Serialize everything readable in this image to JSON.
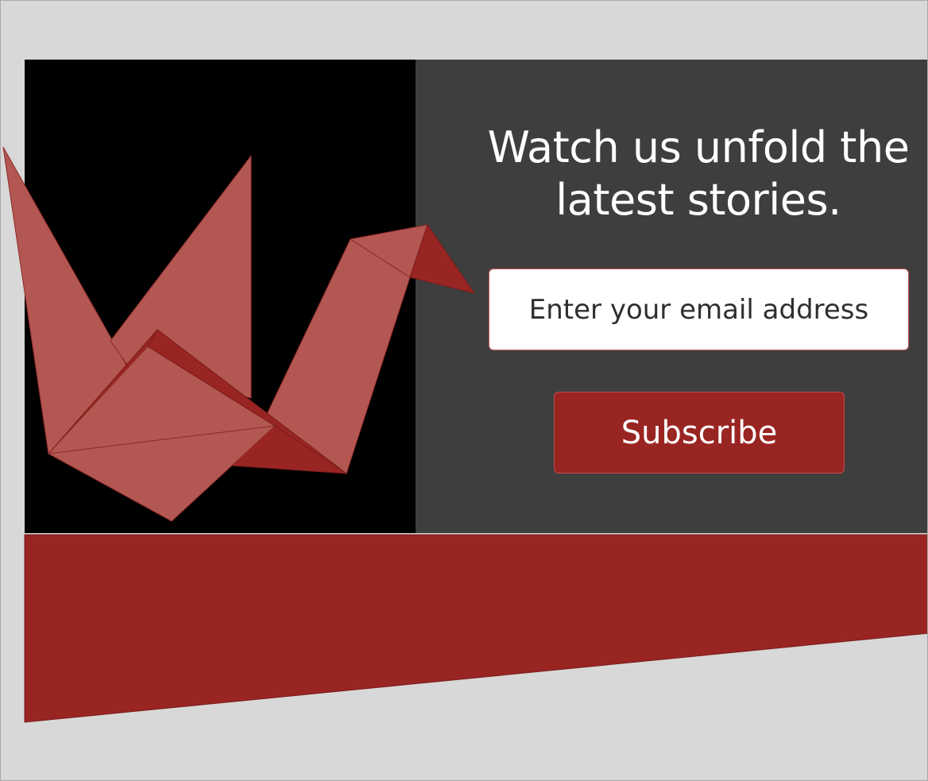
{
  "signup": {
    "headline_line1": "Watch us unfold the",
    "headline_line2": "latest stories.",
    "email_placeholder": "Enter your email address",
    "subscribe_label": "Subscribe"
  },
  "colors": {
    "page_background": "#d8d8d8",
    "left_panel": "#000000",
    "right_panel": "#3e3e3e",
    "accent_red": "#992523",
    "crane_light": "#b35753",
    "crane_dark": "#992523"
  },
  "icons": {
    "crane": "origami-crane-icon"
  }
}
